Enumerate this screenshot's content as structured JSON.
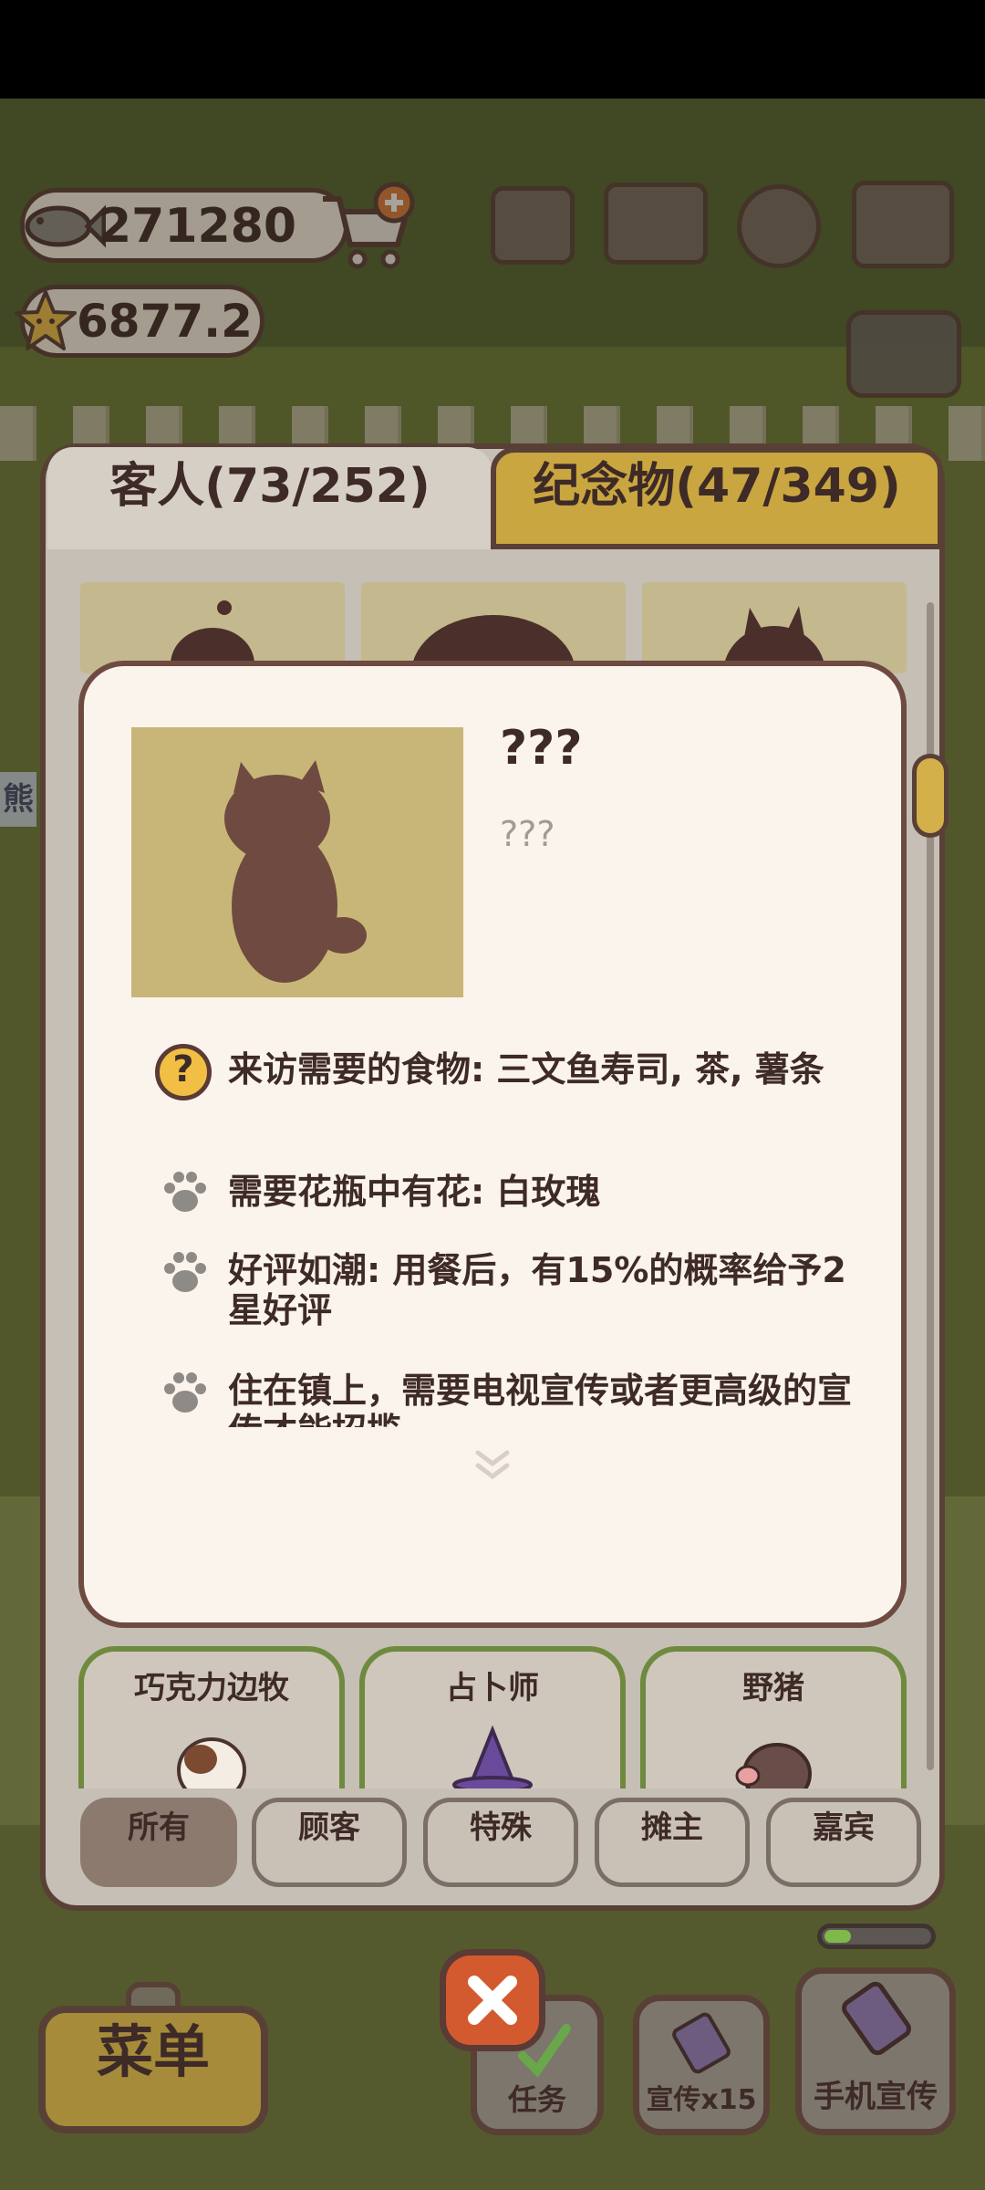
{
  "currency": {
    "fish_amount": "271280",
    "star_amount": "6877.2"
  },
  "tabs": {
    "guests_label": "客人(73/252)",
    "souvenirs_label": "纪念物(47/349)"
  },
  "detail": {
    "name": "???",
    "subtitle": "???",
    "requirements": [
      {
        "icon": "question-icon",
        "text": "来访需要的食物: 三文鱼寿司, 茶, 薯条"
      },
      {
        "icon": "paw-icon",
        "text": "需要花瓶中有花: 白玫瑰"
      },
      {
        "icon": "paw-icon",
        "text": "好评如潮: 用餐后，有15%的概率给予2星好评"
      },
      {
        "icon": "paw-icon",
        "text": "住在镇上，需要电视宣传或者更高级的宣传才能招揽"
      }
    ]
  },
  "guest_cards": [
    {
      "label": "巧克力边牧"
    },
    {
      "label": "占卜师"
    },
    {
      "label": "野猪"
    }
  ],
  "filters": [
    {
      "label": "所有",
      "active": true
    },
    {
      "label": "顾客",
      "active": false
    },
    {
      "label": "特殊",
      "active": false
    },
    {
      "label": "摊主",
      "active": false
    },
    {
      "label": "嘉宾",
      "active": false
    }
  ],
  "hud": {
    "menu_label": "菜单",
    "task_label": "任务",
    "promo_label": "宣传x15",
    "phone_promo_label": "手机宣传",
    "side_label": "熊",
    "progress": 0.25
  },
  "colors": {
    "accent_gold": "#c9a640",
    "outline": "#594037",
    "modal_bg": "#fbf4ec",
    "close_red": "#d35a2e",
    "active_filter": "#8b7a6d"
  }
}
